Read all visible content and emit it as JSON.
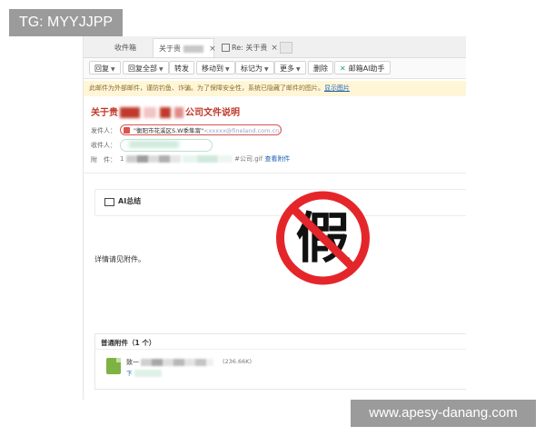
{
  "watermarks": {
    "top_left": "TG: MYYJJPP",
    "bottom_right": "www.apesy-danang.com"
  },
  "tabs": [
    {
      "label": "收件箱"
    },
    {
      "label": "关于贵",
      "close": "×"
    },
    {
      "label": "Re: 关于贵",
      "close": "×"
    }
  ],
  "toolbar": {
    "reply": "回复",
    "reply_all": "回复全部",
    "forward": "转发",
    "move_to": "移动到",
    "mark_as": "标记为",
    "more": "更多",
    "delete": "删除",
    "ai_assistant": "邮箱AI助手"
  },
  "notice": {
    "text": "此邮件为外部邮件，谨防钓鱼、诈骗。为了保障安全性，系统已隐藏了邮件的图片。",
    "link": "显示图片"
  },
  "email": {
    "subject_start": "关于贵",
    "subject_end": "公司文件说明",
    "sender_label": "发件人：",
    "sender_name": "\"衡阳市花溪区S.W季隼甯\"",
    "sender_email": "<xxxxx@fineland.com.cn>",
    "recipient_label": "收件人：",
    "attachment_label": "附　件：",
    "attachment_prefix": "1",
    "attachment_suffix": "#公司.gif",
    "view_attachment": "查看附件",
    "ai_summary_label": "AI总结",
    "body_text": "详情请见附件。"
  },
  "attachments": {
    "header": "普通附件（1 个）",
    "file_name_start": "致一",
    "file_size": "(236.66K)",
    "file_action": "下"
  },
  "stamp": {
    "glyph": "假",
    "color": "#e4262b"
  }
}
